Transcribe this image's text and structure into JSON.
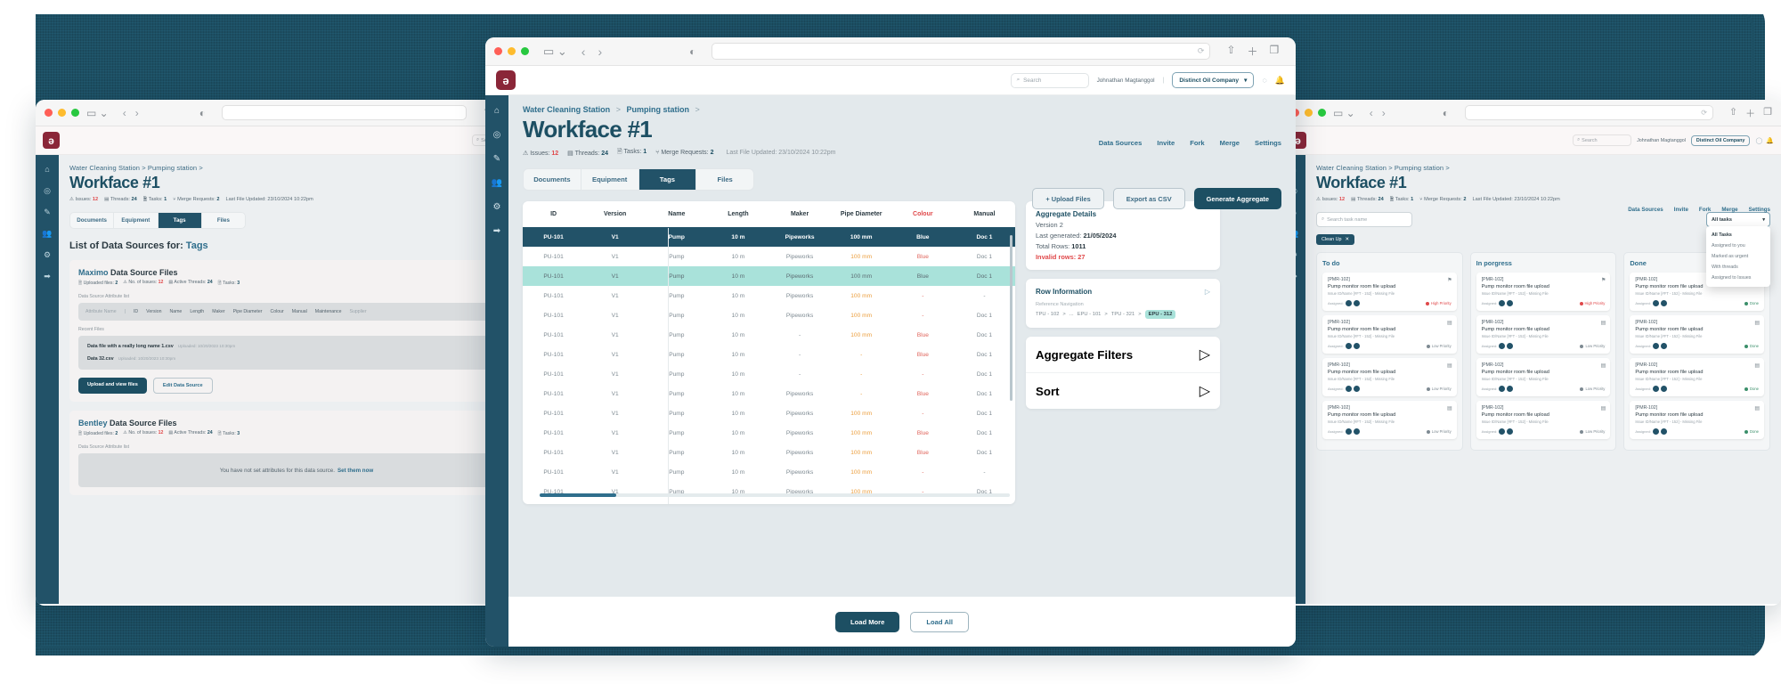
{
  "front": {
    "browser": {
      "url_value": "",
      "reload_icon": "reload-icon"
    },
    "header": {
      "logo": "app-logo",
      "search_placeholder": "Search",
      "user_name": "Johnathan Magtanggol",
      "separator": "|",
      "org_name": "Distinct Oil Company",
      "help_icon": "help-icon",
      "bell_icon": "notification-icon"
    },
    "sidebar": [
      {
        "icon": "home-icon",
        "label": "Home"
      },
      {
        "icon": "check-circle-icon",
        "label": "Tasks"
      },
      {
        "icon": "edit-icon",
        "label": "Edit"
      },
      {
        "icon": "users-icon",
        "label": "Team"
      },
      {
        "icon": "gear-icon",
        "label": "Settings"
      },
      {
        "icon": "logout-icon",
        "label": "Log out"
      }
    ],
    "breadcrumb": [
      "Water Cleaning Station",
      "Pumping station"
    ],
    "breadcrumb_sep": ">",
    "title": "Workface #1",
    "meta": {
      "issues_label": "Issues:",
      "issues_value": "12",
      "threads_label": "Threads:",
      "threads_value": "24",
      "tasks_label": "Tasks:",
      "tasks_value": "1",
      "merge_label": "Merge Requests:",
      "merge_value": "2",
      "last_updated": "Last File Updated: 23/10/2024 10:22pm"
    },
    "actions": [
      "Data Sources",
      "Invite",
      "Fork",
      "Merge",
      "Settings"
    ],
    "tabs": [
      {
        "label": "Documents",
        "active": false
      },
      {
        "label": "Equipment",
        "active": false
      },
      {
        "label": "Tags",
        "active": true
      },
      {
        "label": "Files",
        "active": false
      }
    ],
    "toolbar_buttons": [
      {
        "label": "+ Upload Files",
        "style": "out"
      },
      {
        "label": "Export as CSV",
        "style": "out"
      },
      {
        "label": "Generate Aggregate",
        "style": "fill"
      }
    ],
    "table": {
      "columns": [
        {
          "label": "ID",
          "red": false
        },
        {
          "label": "Version",
          "red": false
        },
        {
          "label": "Name",
          "red": false
        },
        {
          "label": "Length",
          "red": false
        },
        {
          "label": "Maker",
          "red": false
        },
        {
          "label": "Pipe Diameter",
          "red": false
        },
        {
          "label": "Colour",
          "red": true
        },
        {
          "label": "Manual",
          "red": false
        }
      ],
      "rows": [
        {
          "state": "sel",
          "cells": [
            "PU-101",
            "V1",
            "Pump",
            "10 m",
            "Pipeworks",
            "100 mm",
            "Blue",
            "Doc 1"
          ],
          "flags": [
            "",
            "",
            "",
            "",
            "",
            "",
            "",
            ""
          ]
        },
        {
          "state": "",
          "cells": [
            "PU-101",
            "V1",
            "Pump",
            "10 m",
            "Pipeworks",
            "100 mm",
            "Blue",
            "Doc 1"
          ],
          "flags": [
            "",
            "",
            "",
            "",
            "",
            "amber",
            "rose",
            ""
          ]
        },
        {
          "state": "hi",
          "cells": [
            "PU-101",
            "V1",
            "Pump",
            "10 m",
            "Pipeworks",
            "100 mm",
            "Blue",
            "Doc 1"
          ],
          "flags": [
            "",
            "",
            "",
            "",
            "",
            "",
            "rose",
            ""
          ]
        },
        {
          "state": "",
          "cells": [
            "PU-101",
            "V1",
            "Pump",
            "10 m",
            "Pipeworks",
            "100 mm",
            "-",
            "-"
          ],
          "flags": [
            "",
            "",
            "",
            "",
            "",
            "amber",
            "rose",
            ""
          ]
        },
        {
          "state": "",
          "cells": [
            "PU-101",
            "V1",
            "Pump",
            "10 m",
            "Pipeworks",
            "100 mm",
            "-",
            "Doc 1"
          ],
          "flags": [
            "",
            "",
            "",
            "",
            "",
            "amber",
            "rose",
            ""
          ]
        },
        {
          "state": "",
          "cells": [
            "PU-101",
            "V1",
            "Pump",
            "10 m",
            "-",
            "100 mm",
            "Blue",
            "Doc 1"
          ],
          "flags": [
            "",
            "",
            "",
            "",
            "",
            "amber",
            "rose",
            ""
          ]
        },
        {
          "state": "",
          "cells": [
            "PU-101",
            "V1",
            "Pump",
            "10 m",
            "-",
            "-",
            "Blue",
            "Doc 1"
          ],
          "flags": [
            "",
            "",
            "",
            "",
            "",
            "amber",
            "rose",
            ""
          ]
        },
        {
          "state": "",
          "cells": [
            "PU-101",
            "V1",
            "Pump",
            "10 m",
            "-",
            "-",
            "-",
            "Doc 1"
          ],
          "flags": [
            "",
            "",
            "",
            "",
            "",
            "amber",
            "rose",
            ""
          ]
        },
        {
          "state": "",
          "cells": [
            "PU-101",
            "V1",
            "Pump",
            "10 m",
            "Pipeworks",
            "-",
            "Blue",
            "Doc 1"
          ],
          "flags": [
            "",
            "",
            "",
            "",
            "",
            "amber",
            "rose",
            ""
          ]
        },
        {
          "state": "",
          "cells": [
            "PU-101",
            "V1",
            "Pump",
            "10 m",
            "Pipeworks",
            "100 mm",
            "-",
            "Doc 1"
          ],
          "flags": [
            "",
            "",
            "",
            "",
            "",
            "amber",
            "rose",
            ""
          ]
        },
        {
          "state": "",
          "cells": [
            "PU-101",
            "V1",
            "Pump",
            "10 m",
            "Pipeworks",
            "100 mm",
            "Blue",
            "Doc 1"
          ],
          "flags": [
            "",
            "",
            "",
            "",
            "",
            "amber",
            "rose",
            ""
          ]
        },
        {
          "state": "",
          "cells": [
            "PU-101",
            "V1",
            "Pump",
            "10 m",
            "Pipeworks",
            "100 mm",
            "Blue",
            "Doc 1"
          ],
          "flags": [
            "",
            "",
            "",
            "",
            "",
            "amber",
            "rose",
            ""
          ]
        },
        {
          "state": "",
          "cells": [
            "PU-101",
            "V1",
            "Pump",
            "10 m",
            "Pipeworks",
            "100 mm",
            "-",
            "-"
          ],
          "flags": [
            "",
            "",
            "",
            "",
            "",
            "amber",
            "rose",
            ""
          ]
        },
        {
          "state": "",
          "cells": [
            "PU-101",
            "V1",
            "Pump",
            "10 m",
            "Pipeworks",
            "100 mm",
            "-",
            "Doc 1"
          ],
          "flags": [
            "",
            "",
            "",
            "",
            "",
            "amber",
            "rose",
            ""
          ]
        }
      ]
    },
    "aggregate": {
      "title": "Aggregate Details",
      "version": "Version 2",
      "last_generated_label": "Last generated:",
      "last_generated_value": "21/05/2024",
      "total_rows_label": "Total Rows:",
      "total_rows_value": "1011",
      "invalid_rows": "Invalid rows: 27"
    },
    "row_information": {
      "title": "Row Information",
      "caption": "Reference Navigation",
      "path": [
        "TPU - 102",
        "...",
        "EPU - 101",
        "TPU - 321"
      ],
      "current": "EPU - 312",
      "sep": ">",
      "caret": "chevron-right-icon"
    },
    "filters_panel": {
      "title": "Aggregate Filters",
      "caret": "chevron-right-icon"
    },
    "sort_panel": {
      "title": "Sort",
      "caret": "chevron-right-icon"
    },
    "footer_buttons": [
      {
        "label": "Load More",
        "style": "fill"
      },
      {
        "label": "Load All",
        "style": "out"
      }
    ]
  },
  "left_window": {
    "header_search_placeholder": "Search",
    "breadcrumb": [
      "Water Cleaning Station",
      "Pumping station"
    ],
    "breadcrumb_sep": ">",
    "title": "Workface #1",
    "meta": {
      "issues_label": "Issues:",
      "issues_value": "12",
      "threads_label": "Threads:",
      "threads_value": "24",
      "tasks_label": "Tasks:",
      "tasks_value": "1",
      "merge_label": "Merge Requests:",
      "merge_value": "2",
      "last_updated": "Last File Updated: 23/10/2024 10:22pm"
    },
    "tabs": [
      {
        "label": "Documents",
        "active": false
      },
      {
        "label": "Equipment",
        "active": false
      },
      {
        "label": "Tags",
        "active": true
      },
      {
        "label": "Files",
        "active": false
      }
    ],
    "list_heading_prefix": "List of Data Sources for: ",
    "list_heading_suffix": "Tags",
    "sources": [
      {
        "name": "Maximo",
        "suffix": "Data Source Files",
        "uploaded_label": "Uploaded files:",
        "uploaded_value": "2",
        "issues_label": "No. of Issues:",
        "issues_value": "12",
        "threads_label": "Active Threads:",
        "threads_value": "24",
        "tasks_label": "Tasks:",
        "tasks_value": "3",
        "attr_list_label": "Data Source Attribute list",
        "attributes": [
          "Attribute Name",
          "|",
          "ID",
          "Version",
          "Name",
          "Length",
          "Maker",
          "Pipe Diameter",
          "Colour",
          "Manual",
          "Maintenance",
          "Supplier"
        ],
        "recent_files_label": "Recent Files",
        "files": [
          {
            "name": "Data file with a really long name 1.csv",
            "uploaded": "Uploaded: 10/20/2023 10:30pm"
          },
          {
            "name": "Data 32.csv",
            "uploaded": "Uploaded: 10/20/2023 10:30pm"
          }
        ],
        "primary_button": "Upload and view files",
        "secondary_button": "Edit Data Source"
      },
      {
        "name": "Bentley",
        "suffix": "Data Source Files",
        "uploaded_label": "Uploaded files:",
        "uploaded_value": "2",
        "issues_label": "No. of Issues:",
        "issues_value": "12",
        "threads_label": "Active Threads:",
        "threads_value": "24",
        "tasks_label": "Tasks:",
        "tasks_value": "3",
        "attr_list_label": "Data Source Attribute list",
        "empty_text": "You have not set attributes for this data source.",
        "empty_link": "Set them now"
      }
    ]
  },
  "right_window": {
    "header_search_placeholder": "Search",
    "user_name": "Johnathan Magtanggol",
    "org_name": "Distinct Oil Company",
    "breadcrumb": [
      "Water Cleaning Station",
      "Pumping station"
    ],
    "title": "Workface #1",
    "meta": {
      "issues_label": "Issues:",
      "issues_value": "12",
      "threads_label": "Threads:",
      "threads_value": "24",
      "tasks_label": "Tasks:",
      "tasks_value": "1",
      "merge_label": "Merge Requests:",
      "merge_value": "2",
      "last_updated": "Last File Updated: 23/10/2024 10:22pm"
    },
    "actions": [
      "Data Sources",
      "Invite",
      "Fork",
      "Merge",
      "Settings"
    ],
    "task_search_placeholder": "Search task name",
    "filter_selected": "All tasks",
    "filter_options": [
      "All Tasks",
      "Assigned to you",
      "Marked as urgent",
      "With threads",
      "Assigned to Issues"
    ],
    "chip_label": "Clean Up",
    "chip_close": "close-icon",
    "columns": [
      {
        "title": "To do",
        "cards": [
          {
            "id": "[PMR-102]",
            "title": "Pump monitor room file upload",
            "sub": "Issue ID/Name [#FT - 152] - Missing File",
            "assigned_label": "Assigned:",
            "priority": "High Priority",
            "priority_kind": "high",
            "flag": "flag-icon"
          },
          {
            "id": "[PMR-102]",
            "title": "Pump monitor room file upload",
            "sub": "Issue ID/Name [#FT - 152] - Missing File",
            "assigned_label": "Assigned:",
            "priority": "Low Priority",
            "priority_kind": "low",
            "flag": "note-icon"
          },
          {
            "id": "[PMR-102]",
            "title": "Pump monitor room file upload",
            "sub": "Issue ID/Name [#FT - 152] - Missing File",
            "assigned_label": "Assigned:",
            "priority": "Low Priority",
            "priority_kind": "low",
            "flag": "note-icon"
          },
          {
            "id": "[PMR-102]",
            "title": "Pump monitor room file upload",
            "sub": "Issue ID/Name [#FT - 152] - Missing File",
            "assigned_label": "Assigned:",
            "priority": "Low Priority",
            "priority_kind": "low",
            "flag": "note-icon"
          }
        ]
      },
      {
        "title": "In porgress",
        "cards": [
          {
            "id": "[PMR-102]",
            "title": "Pump monitor room file upload",
            "sub": "Issue ID/Name [#FT - 152] - Missing File",
            "assigned_label": "Assigned:",
            "priority": "High Priority",
            "priority_kind": "high",
            "flag": "flag-icon"
          },
          {
            "id": "[PMR-102]",
            "title": "Pump monitor room file upload",
            "sub": "Issue ID/Name [#FT - 152] - Missing File",
            "assigned_label": "Assigned:",
            "priority": "Low Priority",
            "priority_kind": "low",
            "flag": "note-icon"
          },
          {
            "id": "[PMR-102]",
            "title": "Pump monitor room file upload",
            "sub": "Issue ID/Name [#FT - 152] - Missing File",
            "assigned_label": "Assigned:",
            "priority": "Low Priority",
            "priority_kind": "low",
            "flag": "note-icon"
          },
          {
            "id": "[PMR-102]",
            "title": "Pump monitor room file upload",
            "sub": "Issue ID/Name [#FT - 152] - Missing File",
            "assigned_label": "Assigned:",
            "priority": "Low Priority",
            "priority_kind": "low",
            "flag": "note-icon"
          }
        ]
      },
      {
        "title": "Done",
        "cards": [
          {
            "id": "[PMR-102]",
            "title": "Pump monitor room file upload",
            "sub": "Issue ID/Name [#FT - 152] - Missing File",
            "assigned_label": "Assigned:",
            "priority": "Done",
            "priority_kind": "done",
            "flag": "note-icon"
          },
          {
            "id": "[PMR-102]",
            "title": "Pump monitor room file upload",
            "sub": "Issue ID/Name [#FT - 152] - Missing File",
            "assigned_label": "Assigned:",
            "priority": "Done",
            "priority_kind": "done",
            "flag": "note-icon"
          },
          {
            "id": "[PMR-102]",
            "title": "Pump monitor room file upload",
            "sub": "Issue ID/Name [#FT - 152] - Missing File",
            "assigned_label": "Assigned:",
            "priority": "Done",
            "priority_kind": "done",
            "flag": "note-icon"
          },
          {
            "id": "[PMR-102]",
            "title": "Pump monitor room file upload",
            "sub": "Issue ID/Name [#FT - 152] - Missing File",
            "assigned_label": "Assigned:",
            "priority": "Done",
            "priority_kind": "done",
            "flag": "note-icon"
          }
        ]
      }
    ]
  },
  "colors": {
    "brand_teal": "#1d4f63",
    "accent_teal": "#2f6e8c",
    "highlight_mint": "#a9e2da",
    "error_red": "#e0484a",
    "warn_amber": "#eb9e3d",
    "logo_maroon": "#8a2638"
  }
}
